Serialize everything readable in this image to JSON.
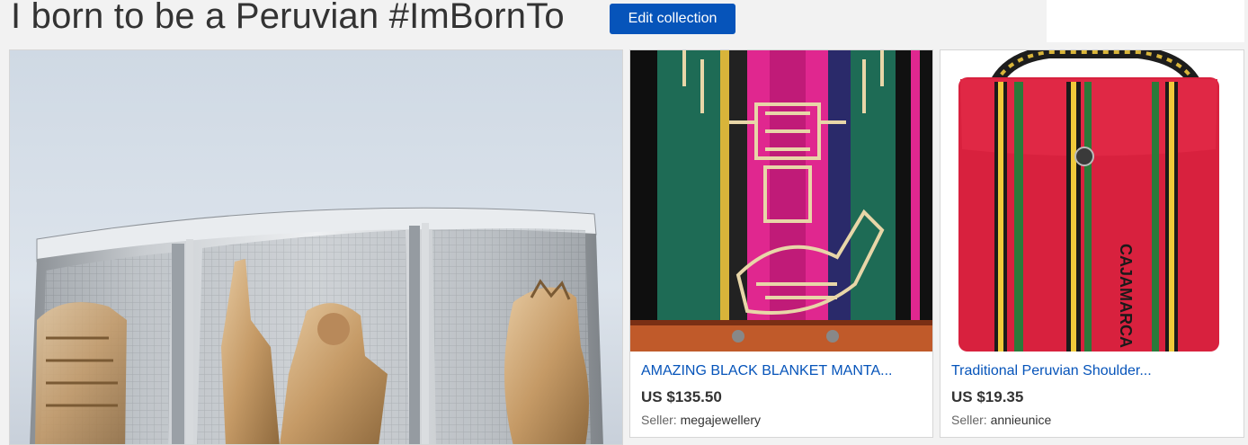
{
  "page": {
    "title": "I born to be a Peruvian #ImBornTo",
    "edit_button_label": "Edit collection"
  },
  "items": [
    {
      "image": "silver-gold-inca-cuff-bracelet"
    },
    {
      "image": "black-green-pink-inca-blanket",
      "title": "AMAZING BLACK BLANKET MANTA...",
      "price": "US $135.50",
      "seller_label": "Seller:",
      "seller": "megajewellery"
    },
    {
      "image": "red-striped-cajamarca-shoulder-bag",
      "title": "Traditional Peruvian Shoulder...",
      "price": "US $19.35",
      "seller_label": "Seller:",
      "seller": "annieunice",
      "bag_text": "CAJAMARCA"
    }
  ]
}
